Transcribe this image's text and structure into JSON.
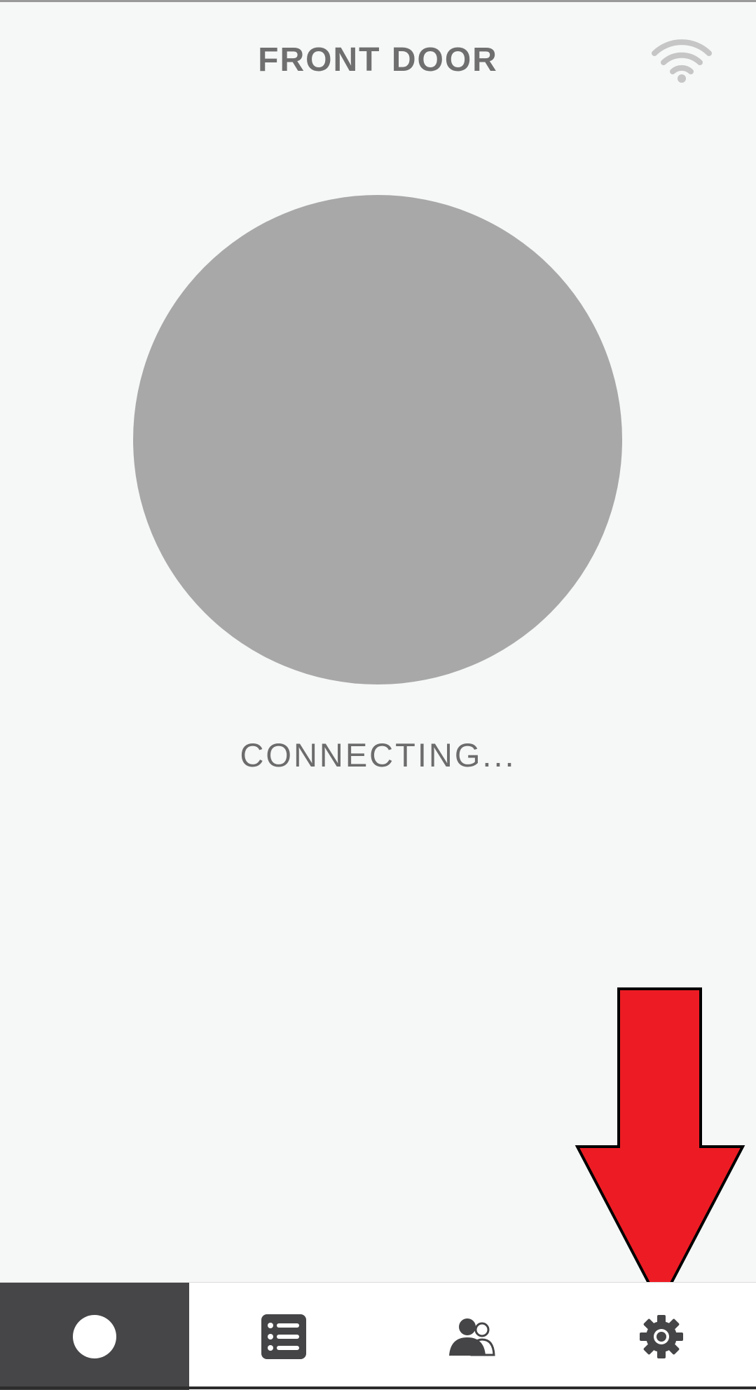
{
  "header": {
    "title": "FRONT DOOR",
    "wifi_icon": "wifi-icon"
  },
  "main": {
    "status_text": "CONNECTING...",
    "circle_color": "#a8a8a8"
  },
  "tabbar": {
    "tabs": [
      {
        "icon": "circle-icon",
        "active": true
      },
      {
        "icon": "list-icon",
        "active": false
      },
      {
        "icon": "users-icon",
        "active": false
      },
      {
        "icon": "gear-icon",
        "active": false
      }
    ],
    "active_color": "#464648"
  },
  "annotation": {
    "arrow_color": "#ed1c24",
    "points_to": "gear-icon"
  },
  "colors": {
    "background": "#f6f7f7",
    "text": "#6f6f6f",
    "icon_dark": "#454547"
  }
}
